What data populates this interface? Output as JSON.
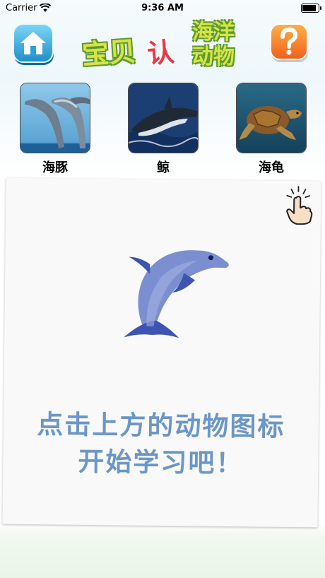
{
  "status_bar": {
    "carrier": "Carrier",
    "time": "9:36 AM"
  },
  "header": {
    "title_part1": "宝贝",
    "title_part2": "认",
    "title_part3_line1": "海洋",
    "title_part3_line2": "动物",
    "home_icon": "home-icon",
    "help_icon": "question-icon"
  },
  "animals": [
    {
      "name": "海豚"
    },
    {
      "name": "鲸"
    },
    {
      "name": "海龟"
    }
  ],
  "card": {
    "prompt_line1": "点击上方的动物图标",
    "prompt_line2": "开始学习吧！",
    "tap_icon": "tap-hand-icon",
    "illustration": "dolphin-icon"
  },
  "colors": {
    "prompt": "#6b97c6",
    "dolphin": "#7b8fd0",
    "help_button": "#f37a1f",
    "home_button": "#34a8dc"
  }
}
